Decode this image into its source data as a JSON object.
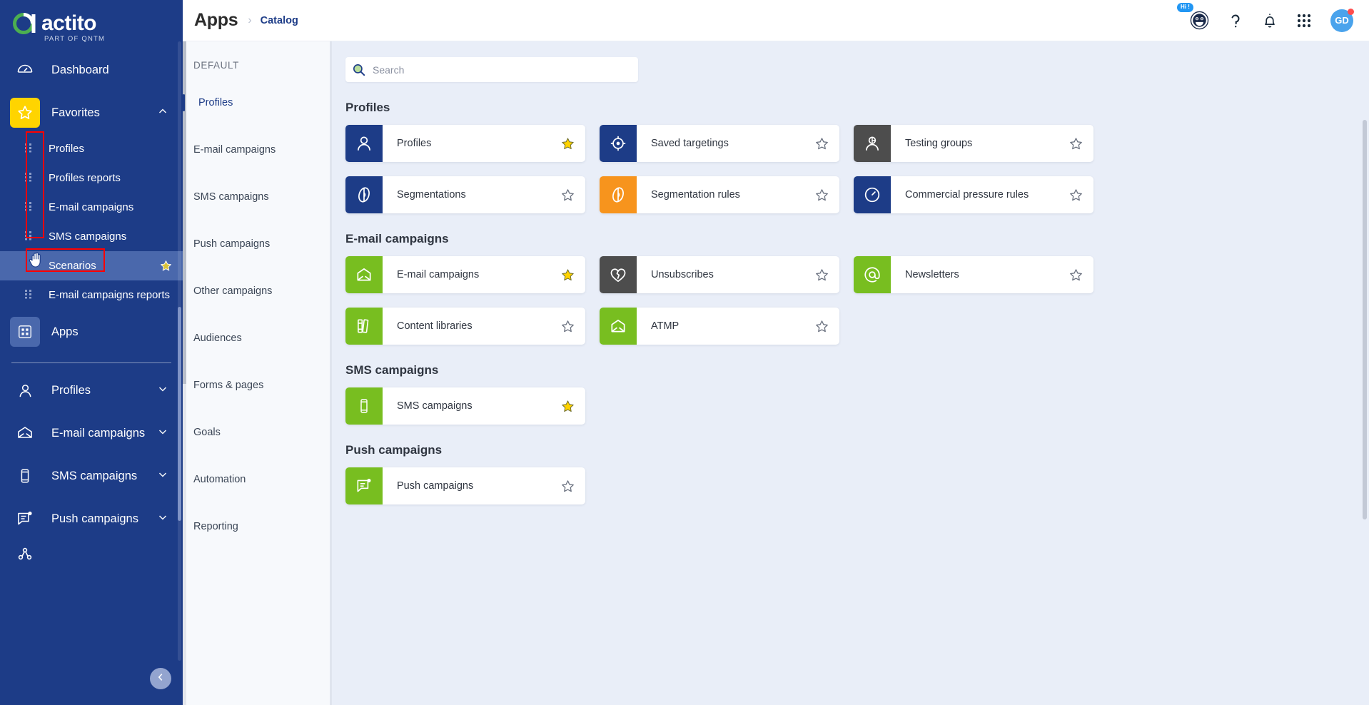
{
  "brand": {
    "name": "actito",
    "tagline": "PART OF QNTM",
    "navy": "#1d3c87",
    "green": "#78be20",
    "orange": "#f7941d",
    "yellow": "#ffd400",
    "gray": "#4d4d4d"
  },
  "leftnav": {
    "dashboard": {
      "label": "Dashboard",
      "icon": "dashboard-icon"
    },
    "favorites": {
      "label": "Favorites",
      "icon": "star-icon",
      "chevron": "chevron-up-icon"
    },
    "favorite_items": [
      {
        "label": "Profiles",
        "icon": "grip-icon"
      },
      {
        "label": "Profiles reports",
        "icon": "grip-icon"
      },
      {
        "label": "E-mail campaigns",
        "icon": "grip-icon"
      },
      {
        "label": "SMS campaigns",
        "icon": "grip-icon"
      },
      {
        "label": "Scenarios",
        "icon": "hand-cursor-icon",
        "active": true,
        "starred": true
      },
      {
        "label": "E-mail campaigns reports",
        "icon": "grip-icon"
      }
    ],
    "apps": {
      "label": "Apps",
      "icon": "apps-grid-icon"
    },
    "sections": [
      {
        "label": "Profiles",
        "icon": "person-icon",
        "chevron": "chevron-down-icon"
      },
      {
        "label": "E-mail campaigns",
        "icon": "envelope-icon",
        "chevron": "chevron-down-icon"
      },
      {
        "label": "SMS campaigns",
        "icon": "phone-icon",
        "chevron": "chevron-down-icon"
      },
      {
        "label": "Push campaigns",
        "icon": "push-message-icon",
        "chevron": "chevron-down-icon"
      }
    ],
    "collapse": {
      "icon": "chevron-left-icon"
    }
  },
  "header": {
    "title": "Apps",
    "separator": "›",
    "breadcrumb": "Catalog",
    "chatbot": {
      "icon": "chatbot-icon",
      "badge": "Hi !"
    },
    "help": {
      "icon": "question-mark-icon"
    },
    "notifications": {
      "icon": "bell-icon"
    },
    "app_switcher": {
      "icon": "grid-dots-icon"
    },
    "avatar": {
      "initials": "GD",
      "has_alert": true
    }
  },
  "search": {
    "icon": "search-icon",
    "value": "",
    "placeholder": "Search"
  },
  "categories": {
    "heading": "DEFAULT",
    "items": [
      {
        "label": "Profiles",
        "active": true
      },
      {
        "label": "E-mail campaigns",
        "active": false
      },
      {
        "label": "SMS campaigns",
        "active": false
      },
      {
        "label": "Push campaigns",
        "active": false
      },
      {
        "label": "Other campaigns",
        "active": false
      },
      {
        "label": "Audiences",
        "active": false
      },
      {
        "label": "Forms & pages",
        "active": false
      },
      {
        "label": "Goals",
        "active": false
      },
      {
        "label": "Automation",
        "active": false
      },
      {
        "label": "Reporting",
        "active": false
      }
    ]
  },
  "catalog": [
    {
      "title": "Profiles",
      "rows": [
        [
          {
            "label": "Profiles",
            "icon": "person-icon",
            "color": "#1d3c87",
            "starred": true
          },
          {
            "label": "Saved targetings",
            "icon": "target-icon",
            "color": "#1d3c87",
            "starred": false
          },
          {
            "label": "Testing groups",
            "icon": "person-split-icon",
            "color": "#4d4d4d",
            "starred": false
          }
        ],
        [
          {
            "label": "Segmentations",
            "icon": "pie-chart-icon",
            "color": "#1d3c87",
            "starred": false
          },
          {
            "label": "Segmentation rules",
            "icon": "pie-chart-icon",
            "color": "#f7941d",
            "starred": false
          },
          {
            "label": "Commercial pressure rules",
            "icon": "gauge-icon",
            "color": "#1d3c87",
            "starred": false
          }
        ]
      ]
    },
    {
      "title": "E-mail campaigns",
      "rows": [
        [
          {
            "label": "E-mail campaigns",
            "icon": "envelope-icon",
            "color": "#78be20",
            "starred": true
          },
          {
            "label": "Unsubscribes",
            "icon": "broken-heart-icon",
            "color": "#4d4d4d",
            "starred": false
          },
          {
            "label": "Newsletters",
            "icon": "at-sign-icon",
            "color": "#78be20",
            "starred": false
          }
        ],
        [
          {
            "label": "Content libraries",
            "icon": "books-icon",
            "color": "#78be20",
            "starred": false
          },
          {
            "label": "ATMP",
            "icon": "envelope-icon",
            "color": "#78be20",
            "starred": false
          }
        ]
      ]
    },
    {
      "title": "SMS campaigns",
      "rows": [
        [
          {
            "label": "SMS campaigns",
            "icon": "phone-icon",
            "color": "#78be20",
            "starred": true
          }
        ]
      ]
    },
    {
      "title": "Push campaigns",
      "rows": [
        [
          {
            "label": "Push campaigns",
            "icon": "push-message-icon",
            "color": "#78be20",
            "starred": false
          }
        ]
      ]
    }
  ]
}
